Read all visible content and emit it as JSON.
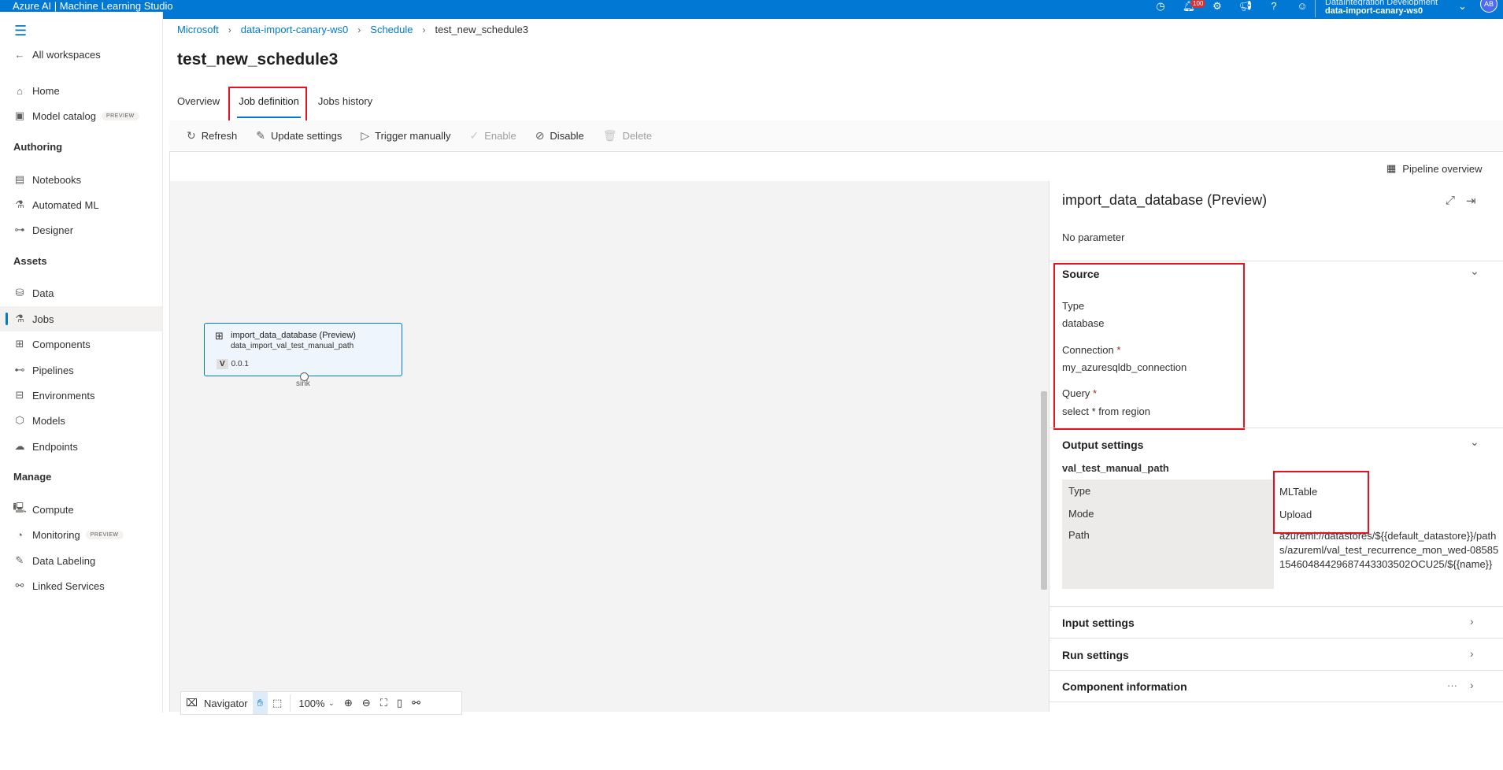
{
  "app": {
    "title": "Azure AI | Machine Learning Studio",
    "notification_count": "100",
    "account_directory": "DataIntegration Development",
    "account_workspace": "data-import-canary-ws0",
    "avatar_initials": "AB",
    "accent_color": "#0078d4"
  },
  "sidebar": {
    "all_workspaces": "All workspaces",
    "home": "Home",
    "model_catalog": "Model catalog",
    "preview_tag": "PREVIEW",
    "authoring_header": "Authoring",
    "notebooks": "Notebooks",
    "automated_ml": "Automated ML",
    "designer": "Designer",
    "assets_header": "Assets",
    "data": "Data",
    "jobs": "Jobs",
    "components": "Components",
    "pipelines": "Pipelines",
    "environments": "Environments",
    "models": "Models",
    "endpoints": "Endpoints",
    "manage_header": "Manage",
    "compute": "Compute",
    "monitoring": "Monitoring",
    "data_labeling": "Data Labeling",
    "linked_services": "Linked Services"
  },
  "breadcrumb": {
    "items": [
      "Microsoft",
      "data-import-canary-ws0",
      "Schedule",
      "test_new_schedule3"
    ]
  },
  "page": {
    "title": "test_new_schedule3",
    "tabs": [
      "Overview",
      "Job definition",
      "Jobs history"
    ],
    "active_tab": "Job definition"
  },
  "toolbar": {
    "refresh": "Refresh",
    "update_settings": "Update settings",
    "trigger_manually": "Trigger manually",
    "enable": "Enable",
    "disable": "Disable",
    "delete": "Delete"
  },
  "canvas": {
    "pipeline_overview": "Pipeline overview",
    "node": {
      "title": "import_data_database (Preview)",
      "subtitle": "data_import_val_test_manual_path",
      "version_tag": "V",
      "version": "0.0.1",
      "port_label": "sink"
    },
    "navigator": {
      "label": "Navigator",
      "zoom": "100%"
    }
  },
  "panel": {
    "title": "import_data_database (Preview)",
    "no_parameter": "No parameter",
    "source": {
      "header": "Source",
      "type_label": "Type",
      "type_value": "database",
      "connection_label": "Connection",
      "connection_value": "my_azuresqldb_connection",
      "query_label": "Query",
      "query_value": "select * from region",
      "required_mark": "*"
    },
    "output": {
      "header": "Output settings",
      "name": "val_test_manual_path",
      "type_label": "Type",
      "type_value": "MLTable",
      "mode_label": "Mode",
      "mode_value": "Upload",
      "path_label": "Path",
      "path_value": "azureml://datastores/${{default_datastore}}/paths/azureml/val_test_recurrence_mon_wed-0858515460484429687443303502OCU25/${{name}}"
    },
    "input_settings": "Input settings",
    "run_settings": "Run settings",
    "component_information": "Component information",
    "more": "···"
  }
}
